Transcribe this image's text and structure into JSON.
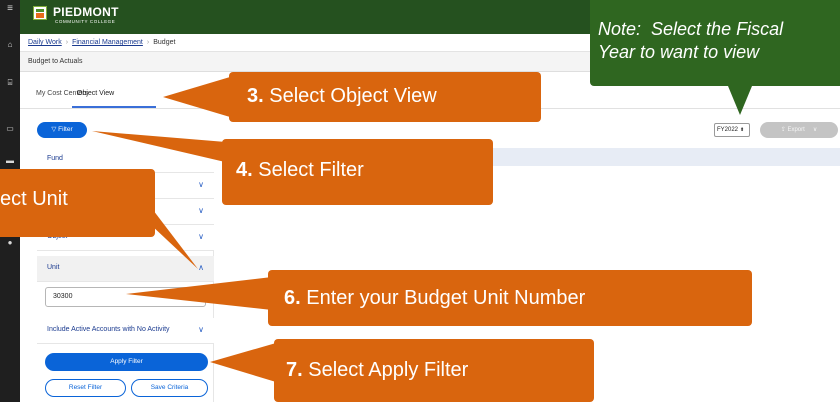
{
  "app": {
    "brand_name": "PIEDMONT",
    "brand_sub": "COMMUNITY COLLEGE"
  },
  "breadcrumb": {
    "items": [
      "Daily Work",
      "Financial Management",
      "Budget"
    ],
    "separator": "›"
  },
  "page": {
    "subtitle": "Budget to Actuals"
  },
  "tabs": [
    {
      "label": "My Cost Centers",
      "active": false
    },
    {
      "label": "Object View",
      "active": true
    }
  ],
  "toolbar": {
    "filter_label": "Filter",
    "fiscal_year": "FY2022",
    "export_label": "Export"
  },
  "filters": {
    "rows": [
      {
        "label": "Fund"
      },
      {
        "label": ""
      },
      {
        "label": ""
      },
      {
        "label": "Object"
      },
      {
        "label": "Unit"
      },
      {
        "label": "Include Active Accounts with No Activity"
      }
    ],
    "unit_value": "30300",
    "apply_label": "Apply Filter",
    "reset_label": "Reset Filter",
    "save_label": "Save Criteria"
  },
  "callouts": {
    "note": "Note:  Select the Fiscal\nYear to want to view",
    "step3_num": "3.",
    "step3_text": " Select Object View",
    "step4_num": "4.",
    "step4_text": " Select Filter",
    "step5_text": "ect Unit",
    "step6_num": "6.",
    "step6_text": " Enter your Budget Unit Number",
    "step7_num": "7.",
    "step7_text": " Select Apply Filter"
  },
  "colors": {
    "header_green": "#25511f",
    "note_green": "#2f6620",
    "callout_orange": "#d9650e",
    "primary_blue": "#0a64d8"
  },
  "icons": [
    "menu-icon",
    "home-icon",
    "bank-icon",
    "id-card-icon",
    "wallet-icon",
    "person-icon",
    "filter-icon",
    "chevron-down-icon",
    "chevron-up-icon",
    "share-icon"
  ]
}
